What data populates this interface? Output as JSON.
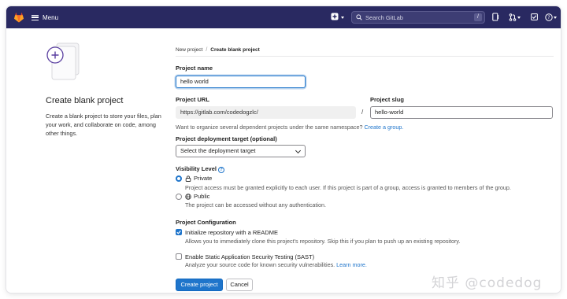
{
  "topbar": {
    "menu_label": "Menu",
    "search_placeholder": "Search GitLab",
    "search_shortcut": "/",
    "colors": {
      "bar": "#292961",
      "accent": "#1f75cb"
    }
  },
  "sidebar": {
    "title": "Create blank project",
    "description": "Create a blank project to store your files, plan your work, and collaborate on code, among other things."
  },
  "breadcrumb": {
    "items": [
      "New project",
      "Create blank project"
    ],
    "separator": "/"
  },
  "form": {
    "project_name": {
      "label": "Project name",
      "value": "hello world"
    },
    "project_url": {
      "label": "Project URL",
      "value": "https://gitlab.com/codedogzlc/"
    },
    "url_separator": "/",
    "project_slug": {
      "label": "Project slug",
      "value": "hello-world"
    },
    "namespace_help": "Want to organize several dependent projects under the same namespace?",
    "namespace_link": "Create a group.",
    "deployment_target": {
      "label": "Project deployment target (optional)",
      "selected": "Select the deployment target"
    },
    "visibility": {
      "label": "Visibility Level",
      "help_icon": "question-icon",
      "options": [
        {
          "label": "Private",
          "icon": "lock-icon",
          "checked": true,
          "description": "Project access must be granted explicitly to each user. If this project is part of a group, access is granted to members of the group."
        },
        {
          "label": "Public",
          "icon": "globe-icon",
          "checked": false,
          "description": "The project can be accessed without any authentication."
        }
      ]
    },
    "configuration": {
      "label": "Project Configuration",
      "options": [
        {
          "label": "Initialize repository with a README",
          "checked": true,
          "description": "Allows you to immediately clone this project's repository. Skip this if you plan to push up an existing repository."
        },
        {
          "label": "Enable Static Application Security Testing (SAST)",
          "checked": false,
          "description": "Analyze your source code for known security vulnerabilities.",
          "link": "Learn more."
        }
      ]
    },
    "buttons": {
      "create": "Create project",
      "cancel": "Cancel"
    }
  },
  "watermark": "知乎 @codedog"
}
